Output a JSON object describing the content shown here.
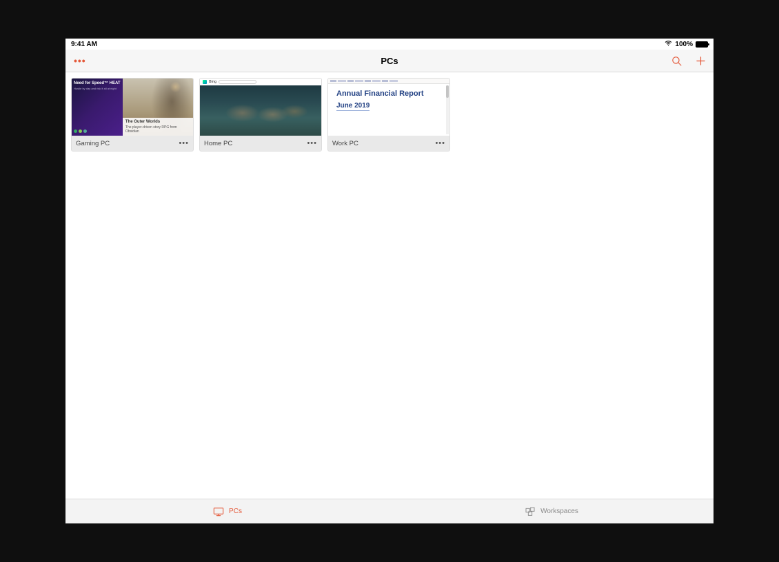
{
  "status": {
    "time": "9:41 AM",
    "battery": "100%"
  },
  "nav": {
    "title": "PCs"
  },
  "pcs": [
    {
      "name": "Gaming PC",
      "thumb": {
        "nfs_title": "Need for Speed™ HEAT",
        "nfs_sub": "Hustle by day and risk it all at night",
        "ow_title": "The Outer Worlds",
        "ow_sub": "The player-driven story RPG from Obsidian"
      }
    },
    {
      "name": "Home PC",
      "thumb": {
        "bing_label": "Bing"
      }
    },
    {
      "name": "Work PC",
      "thumb": {
        "doc_title": "Annual Financial Report",
        "doc_sub": "June 2019"
      }
    }
  ],
  "tabs": {
    "pcs": "PCs",
    "workspaces": "Workspaces"
  },
  "colors": {
    "accent": "#e4593a"
  }
}
